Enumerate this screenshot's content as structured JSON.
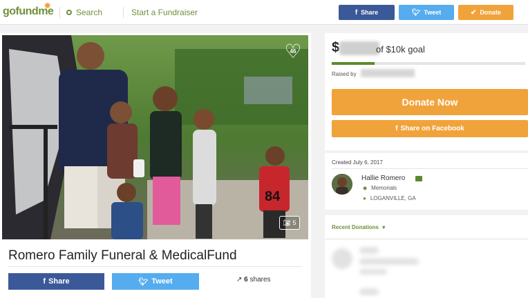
{
  "nav": {
    "logo": "gofundme",
    "search_label": "Search",
    "start_label": "Start a Fundraiser",
    "share_label": "Share",
    "tweet_label": "Tweet",
    "donate_label": "Donate"
  },
  "campaign": {
    "title": "Romero Family Funeral & MedicalFund",
    "heart_count": "46",
    "photo_count": "5",
    "share_button": "Share",
    "tweet_button": "Tweet",
    "shares_count": "6",
    "shares_label": "shares"
  },
  "donation": {
    "currency_symbol": "$",
    "goal_text": "of $10k goal",
    "progress_fraction": 0.22,
    "raised_by_label": "Raised by",
    "donate_now_label": "Donate Now",
    "facebook_share_label": "Share on Facebook"
  },
  "organizer": {
    "created": "Created July 6, 2017",
    "name": "Hallie Romero",
    "category": "Memorials",
    "location": "LOGANVILLE, GA"
  },
  "recent": {
    "header": "Recent Donations"
  },
  "colors": {
    "brand_green": "#6f8f3a",
    "facebook": "#3b5998",
    "twitter": "#55acee",
    "donate_orange": "#f1a33b",
    "progress_green": "#5a8a2e"
  }
}
